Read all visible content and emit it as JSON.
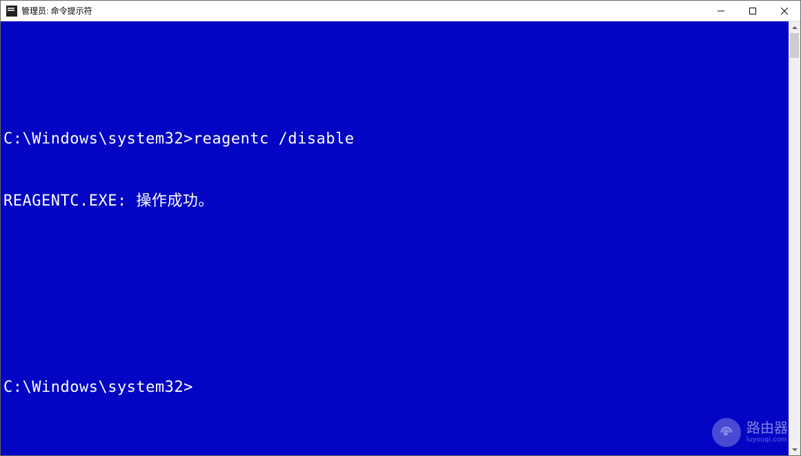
{
  "window": {
    "title": "管理员: 命令提示符"
  },
  "terminal": {
    "lines": [
      {
        "prompt": "C:\\Windows\\system32>",
        "command": "reagentc /disable"
      },
      {
        "output": "REAGENTC.EXE: 操作成功。"
      },
      {
        "output": ""
      },
      {
        "output": ""
      },
      {
        "prompt": "C:\\Windows\\system32>",
        "command": ""
      }
    ]
  },
  "watermark": {
    "label": "路由器",
    "sub": "luyouqi.com"
  }
}
